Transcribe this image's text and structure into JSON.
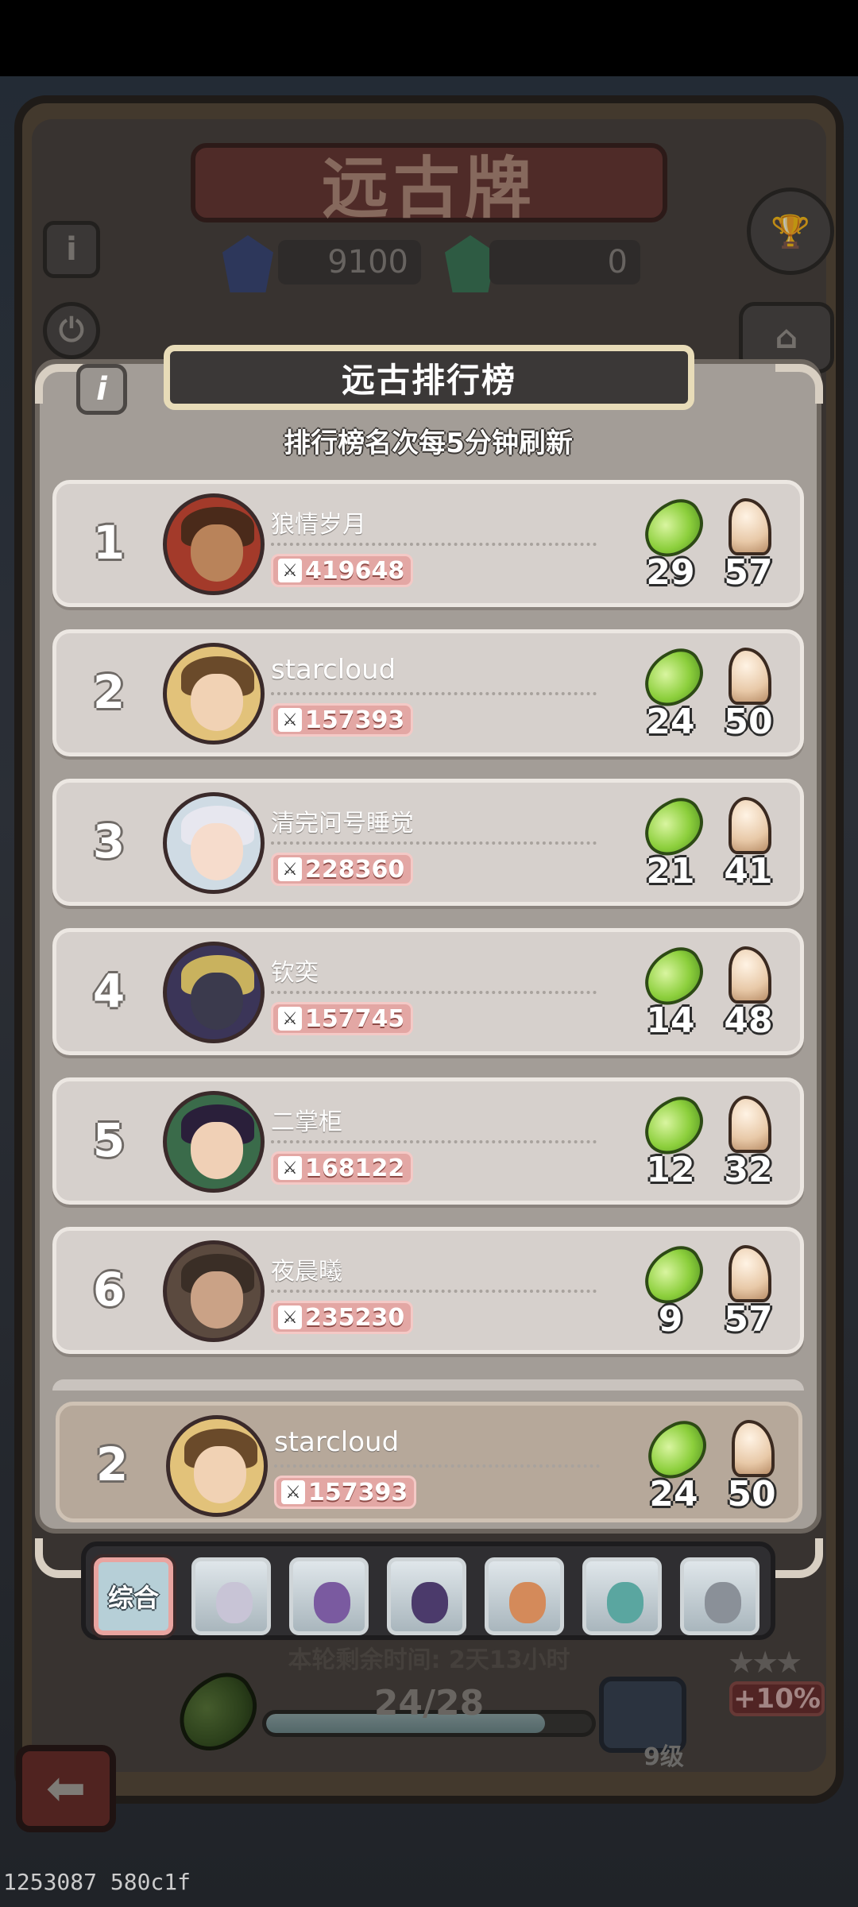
{
  "background": {
    "title": "远古牌",
    "resources": [
      {
        "name": "blue-stone",
        "value": "9100",
        "color": "#3c4a7a"
      },
      {
        "name": "green-stone",
        "value": "0",
        "color": "#3e7a5a"
      }
    ],
    "info_icon": "i",
    "bonus": "+10%",
    "chest_level": "9级",
    "remaining_time": "本轮剩余时间: 2天13小时",
    "progress": {
      "text": "24/28",
      "fraction": 0.857
    }
  },
  "panel": {
    "title": "远古排行榜",
    "subtitle": "排行榜名次每5分钟刷新",
    "info_label": "i"
  },
  "ranking": [
    {
      "rank": "1",
      "name": "狼情岁月",
      "power": "419648",
      "beans": "29",
      "horses": "57",
      "avatar_color": "#a33a2a",
      "skin": "#b9835a",
      "hair": "#4a2a1a"
    },
    {
      "rank": "2",
      "name": "starcloud",
      "power": "157393",
      "beans": "24",
      "horses": "50",
      "avatar_color": "#e2c27a",
      "skin": "#f1d2b4",
      "hair": "#6a4a2a"
    },
    {
      "rank": "3",
      "name": "清完问号睡觉",
      "power": "228360",
      "beans": "21",
      "horses": "41",
      "avatar_color": "#cfdbe4",
      "skin": "#f6dccc",
      "hair": "#e7e7ef"
    },
    {
      "rank": "4",
      "name": "钦奕",
      "power": "157745",
      "beans": "14",
      "horses": "48",
      "avatar_color": "#3b3558",
      "skin": "#3b3a4d",
      "hair": "#c9b25e"
    },
    {
      "rank": "5",
      "name": "二掌柜",
      "power": "168122",
      "beans": "12",
      "horses": "32",
      "avatar_color": "#3a6b4a",
      "skin": "#f0d0b6",
      "hair": "#2a1f3a"
    },
    {
      "rank": "6",
      "name": "夜晨曦",
      "power": "235230",
      "beans": "9",
      "horses": "57",
      "avatar_color": "#5b4a3f",
      "skin": "#caa286",
      "hair": "#3a2e26"
    }
  ],
  "my_rank": {
    "rank": "2",
    "name": "starcloud",
    "power": "157393",
    "beans": "24",
    "horses": "50",
    "avatar_color": "#e2c27a",
    "skin": "#f1d2b4",
    "hair": "#6a4a2a"
  },
  "tabs": [
    {
      "label": "综合",
      "selected": true
    },
    {
      "icon": "white-haired-hero",
      "color": "#c8c4d6"
    },
    {
      "icon": "purple-hooded-hero",
      "color": "#7a5aa0"
    },
    {
      "icon": "dark-horse-hero",
      "color": "#4b3a6b"
    },
    {
      "icon": "red-haired-hero",
      "color": "#d48a5a"
    },
    {
      "icon": "green-goblin-hero",
      "color": "#5aa6a0"
    },
    {
      "icon": "mechanical-hero",
      "color": "#8a9098"
    }
  ],
  "debug_text": "1253087 580c1f"
}
